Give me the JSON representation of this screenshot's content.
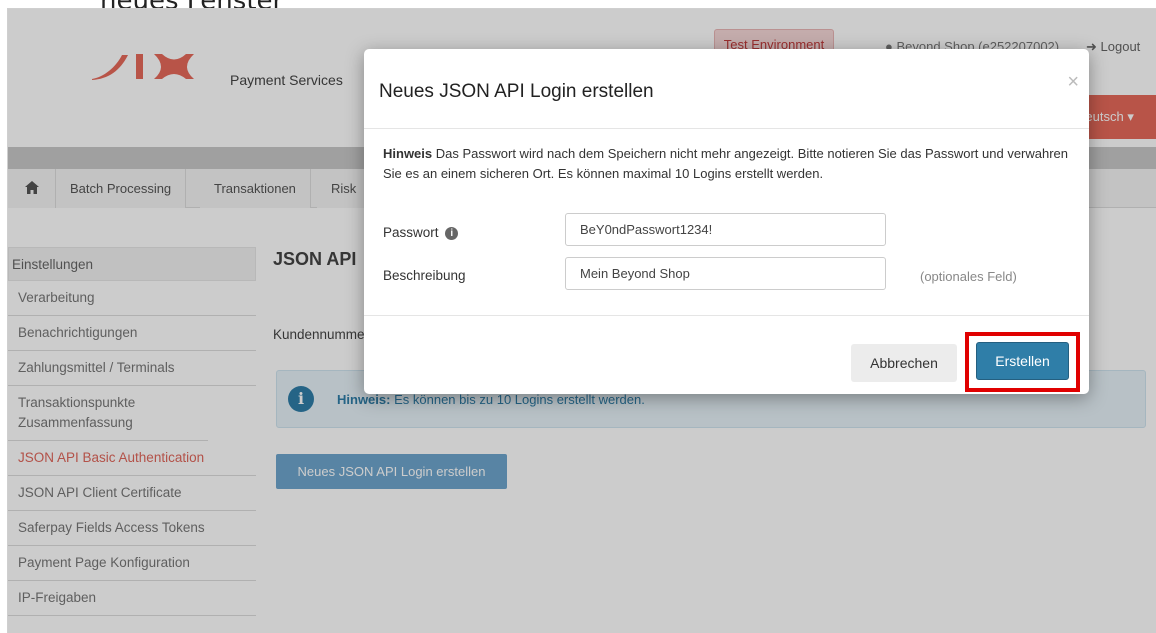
{
  "caption": "neues Fenster",
  "header": {
    "brand_sub": "Payment Services",
    "test_env": "Test Environment",
    "shop_user": "Beyond Shop (e252207002)",
    "logout": "Logout",
    "language": "Deutsch"
  },
  "nav": {
    "items": [
      {
        "label": "Batch Processing"
      },
      {
        "label": "Transaktionen"
      },
      {
        "label": "Risk"
      }
    ]
  },
  "sidebar": {
    "heading": "Einstellungen",
    "items": [
      {
        "label": "Verarbeitung"
      },
      {
        "label": "Benachrichtigungen"
      },
      {
        "label": "Zahlungsmittel / Terminals"
      },
      {
        "label": "Transaktionspunkte Zusammenfassung"
      },
      {
        "label": "JSON API Basic Authentication"
      },
      {
        "label": "JSON API Client Certificate"
      },
      {
        "label": "Saferpay Fields Access Tokens"
      },
      {
        "label": "Payment Page Konfiguration"
      },
      {
        "label": "IP-Freigaben"
      }
    ]
  },
  "content": {
    "title": "JSON API",
    "customer_label": "Kundennummer",
    "info_label": "Hinweis:",
    "info_text": "Es können bis zu 10 Logins erstellt werden.",
    "new_login_button": "Neues JSON API Login erstellen"
  },
  "modal": {
    "title": "Neues JSON API Login erstellen",
    "close": "×",
    "hint_label": "Hinweis",
    "hint_text": "Das Passwort wird nach dem Speichern nicht mehr angezeigt. Bitte notieren Sie das Passwort und verwahren Sie es an einem sicheren Ort. Es können maximal 10 Logins erstellt werden.",
    "password_label": "Passwort",
    "password_value": "BeY0ndPasswort1234!",
    "description_label": "Beschreibung",
    "description_value": "Mein Beyond Shop",
    "optional_hint": "(optionales Feld)",
    "cancel_button": "Abbrechen",
    "create_button": "Erstellen"
  },
  "colors": {
    "brand_red": "#e0675c",
    "primary_blue": "#2f7ea8",
    "highlight_red": "#e00000"
  }
}
